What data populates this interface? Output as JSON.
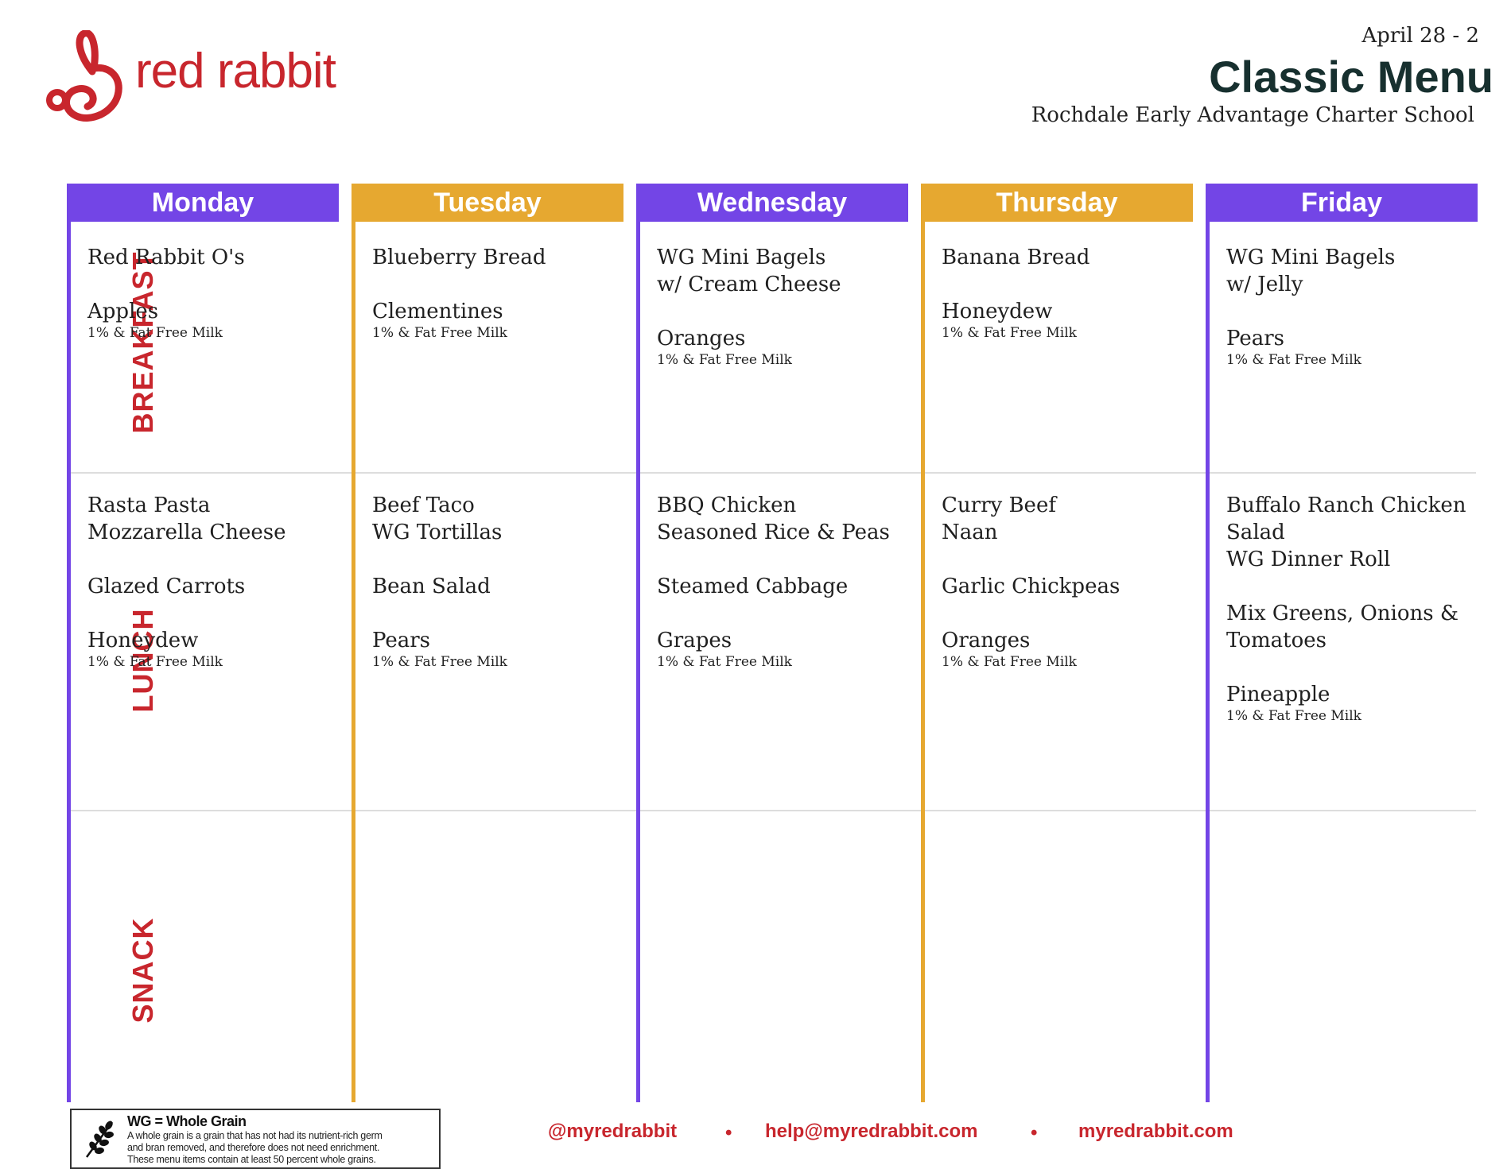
{
  "brand": {
    "name": "red rabbit",
    "color": "#c8262d"
  },
  "header": {
    "date": "April 28 - 2",
    "title": "Classic Menu",
    "school": "Rochdale Early Advantage Charter School"
  },
  "meals": [
    "BREAKFAST",
    "LUNCH",
    "SNACK"
  ],
  "colors": {
    "purple": "#7345e6",
    "gold": "#e6a830"
  },
  "days": [
    {
      "name": "Monday",
      "breakfast": {
        "items": [
          "Red Rabbit O's",
          "",
          "Apples"
        ],
        "milk": "1% & Fat Free Milk"
      },
      "lunch": {
        "items": [
          "Rasta Pasta",
          "Mozzarella Cheese",
          "",
          "Glazed Carrots",
          "",
          "Honeydew"
        ],
        "milk": "1% & Fat Free Milk"
      }
    },
    {
      "name": "Tuesday",
      "breakfast": {
        "items": [
          "Blueberry Bread",
          "",
          "Clementines"
        ],
        "milk": "1% & Fat Free Milk"
      },
      "lunch": {
        "items": [
          "Beef Taco",
          "WG Tortillas",
          "",
          "Bean Salad",
          "",
          "Pears"
        ],
        "milk": "1% & Fat Free Milk"
      }
    },
    {
      "name": "Wednesday",
      "breakfast": {
        "items": [
          "WG Mini Bagels",
          "w/ Cream Cheese",
          "",
          "Oranges"
        ],
        "milk": "1% & Fat Free Milk"
      },
      "lunch": {
        "items": [
          "BBQ Chicken",
          "Seasoned Rice & Peas",
          "",
          "Steamed Cabbage",
          "",
          "Grapes"
        ],
        "milk": "1% & Fat Free Milk"
      }
    },
    {
      "name": "Thursday",
      "breakfast": {
        "items": [
          "Banana Bread",
          "",
          "Honeydew"
        ],
        "milk": "1% & Fat Free Milk"
      },
      "lunch": {
        "items": [
          "Curry Beef",
          "Naan",
          "",
          "Garlic Chickpeas",
          "",
          "Oranges"
        ],
        "milk": "1% & Fat Free Milk"
      }
    },
    {
      "name": "Friday",
      "breakfast": {
        "items": [
          "WG Mini Bagels",
          "w/ Jelly",
          "",
          "Pears"
        ],
        "milk": "1% & Fat Free Milk"
      },
      "lunch": {
        "items": [
          "Buffalo Ranch Chicken",
          "Salad",
          "WG Dinner Roll",
          "",
          "Mix Greens, Onions &",
          "Tomatoes",
          "",
          "Pineapple"
        ],
        "milk": "1% & Fat Free Milk"
      }
    }
  ],
  "legend": {
    "icon": "wheat-icon",
    "heading": "WG = Whole Grain",
    "lines": [
      "A whole grain is a grain that has not had its nutrient-rich germ",
      "and bran removed, and therefore does not need enrichment.",
      "These menu items contain at least 50 percent whole grains."
    ]
  },
  "footer": {
    "handle": "@myredrabbit",
    "email": "help@myredrabbit.com",
    "site": "myredrabbit.com",
    "separator": "•"
  }
}
